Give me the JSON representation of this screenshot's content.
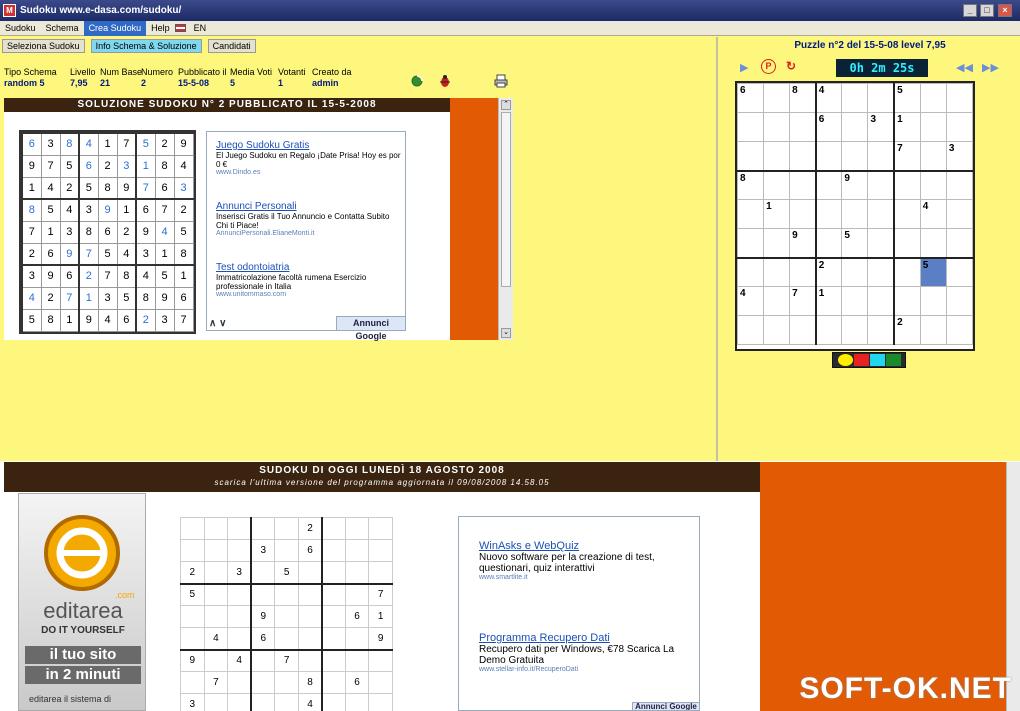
{
  "window": {
    "title": "Sudoku www.e-dasa.com/sudoku/",
    "logo": "M"
  },
  "menu": [
    {
      "label": "Sudoku",
      "active": false
    },
    {
      "label": "Schema",
      "active": false
    },
    {
      "label": "Crea Sudoku",
      "active": true
    },
    {
      "label": "Help",
      "active": false
    },
    {
      "label": "EN",
      "active": false
    }
  ],
  "tabs": [
    "Seleziona Sudoku",
    "Info Schema & Soluzione",
    "Candidati"
  ],
  "info": {
    "labels": [
      "Tipo Schema",
      "Livello",
      "Num Base",
      "Numero",
      "Pubblicato il",
      "Media Voti",
      "Votanti",
      "Creato da"
    ],
    "values": [
      "random 5",
      "7,95",
      "21",
      "2",
      "15-5-08",
      "5",
      "1",
      "admin"
    ]
  },
  "solution": {
    "header": "SOLUZIONE SUDOKU N° 2 PUBBLICATO IL 15-5-2008",
    "grid": [
      [
        "6",
        "3",
        "8",
        "4",
        "1",
        "7",
        "5",
        "2",
        "9"
      ],
      [
        "9",
        "7",
        "5",
        "6",
        "2",
        "3",
        "1",
        "8",
        "4"
      ],
      [
        "1",
        "4",
        "2",
        "5",
        "8",
        "9",
        "7",
        "6",
        "3"
      ],
      [
        "8",
        "5",
        "4",
        "3",
        "9",
        "1",
        "6",
        "7",
        "2"
      ],
      [
        "7",
        "1",
        "3",
        "8",
        "6",
        "2",
        "9",
        "4",
        "5"
      ],
      [
        "2",
        "6",
        "9",
        "7",
        "5",
        "4",
        "3",
        "1",
        "8"
      ],
      [
        "3",
        "9",
        "6",
        "2",
        "7",
        "8",
        "4",
        "5",
        "1"
      ],
      [
        "4",
        "2",
        "7",
        "1",
        "3",
        "5",
        "8",
        "9",
        "6"
      ],
      [
        "5",
        "8",
        "1",
        "9",
        "4",
        "6",
        "2",
        "3",
        "7"
      ]
    ],
    "blue": [
      [
        1,
        0,
        1,
        1,
        0,
        0,
        1,
        0,
        0
      ],
      [
        0,
        0,
        0,
        1,
        0,
        1,
        1,
        0,
        0
      ],
      [
        0,
        0,
        0,
        0,
        0,
        0,
        1,
        0,
        1
      ],
      [
        1,
        0,
        0,
        0,
        1,
        0,
        0,
        0,
        0
      ],
      [
        0,
        0,
        0,
        0,
        0,
        0,
        0,
        1,
        0
      ],
      [
        0,
        0,
        1,
        1,
        0,
        0,
        0,
        0,
        0
      ],
      [
        0,
        0,
        0,
        1,
        0,
        0,
        0,
        0,
        0
      ],
      [
        1,
        0,
        1,
        1,
        0,
        0,
        0,
        0,
        0
      ],
      [
        0,
        0,
        0,
        0,
        0,
        0,
        1,
        0,
        0
      ]
    ]
  },
  "ads_top": [
    {
      "title": "Juego Sudoku Gratis",
      "text": "El Juego Sudoku en Regalo ¡Date Prisa! Hoy es por 0 €",
      "url": "www.Dindo.es"
    },
    {
      "title": "Annunci Personali",
      "text": "Inserisci Gratis il Tuo Annuncio e Contatta Subito Chi ti Piace!",
      "url": "AnnunciPersonali.ElianeMonti.it"
    },
    {
      "title": "Test odontoiatria",
      "text": "Immatricolazione facoltà rumena Esercizio professionale in Italia",
      "url": "www.unitommaso.com"
    }
  ],
  "ads_google": "Annunci Google",
  "ads_nav": "∧ ∨",
  "puzzle": {
    "title": "Puzzle n°2 del 15-5-08 level 7,95",
    "timer": "0h 2m 25s",
    "cells": [
      [
        "6",
        "",
        "8",
        "4",
        "",
        "",
        "5",
        "",
        ""
      ],
      [
        "",
        "",
        "",
        "6",
        "",
        "3",
        "1",
        "",
        ""
      ],
      [
        "",
        "",
        "",
        "",
        "",
        "",
        "7",
        "",
        "3"
      ],
      [
        "8",
        "",
        "",
        "",
        "9",
        "",
        "",
        "",
        ""
      ],
      [
        "",
        "1",
        "",
        "",
        "",
        "",
        "",
        "4",
        ""
      ],
      [
        "",
        "",
        "9",
        "",
        "5",
        "",
        "",
        "",
        ""
      ],
      [
        "",
        "",
        "",
        "2",
        "",
        "",
        "",
        "5",
        ""
      ],
      [
        "4",
        "",
        "7",
        "1",
        "",
        "",
        "",
        "",
        ""
      ],
      [
        "",
        "",
        "",
        "",
        "",
        "",
        "2",
        "",
        ""
      ]
    ],
    "selected": [
      6,
      7
    ],
    "colors": [
      "#ffee00",
      "#e62222",
      "#22d6ee",
      "#1a8a2a"
    ]
  },
  "bottom": {
    "header": "SUDOKU DI OGGI LUNEDÌ 18 AGOSTO 2008",
    "subheader": "scarica l'ultima versione del programma aggiornata il 09/08/2008 14.58.05",
    "grid": [
      [
        "",
        "",
        "",
        "",
        "",
        "2",
        "",
        "",
        ""
      ],
      [
        "",
        "",
        "",
        "3",
        "",
        "6",
        "",
        "",
        ""
      ],
      [
        "2",
        "",
        "3",
        "",
        "5",
        "",
        "",
        "",
        ""
      ],
      [
        "5",
        "",
        "",
        "",
        "",
        "",
        "",
        "",
        "7"
      ],
      [
        "",
        "",
        "",
        "9",
        "",
        "",
        "",
        "6",
        "1"
      ],
      [
        "",
        "4",
        "",
        "6",
        "",
        "",
        "",
        "",
        "9"
      ],
      [
        "9",
        "",
        "4",
        "",
        "7",
        "",
        "",
        "",
        ""
      ],
      [
        "",
        "7",
        "",
        "",
        "",
        "8",
        "",
        "6",
        ""
      ],
      [
        "3",
        "",
        "",
        "",
        "",
        "4",
        "",
        "",
        ""
      ]
    ]
  },
  "editarea": {
    "brand": "editarea",
    "com": ".com",
    "tagline": "DO IT YOURSELF",
    "line1": "il tuo sito",
    "line2": "in 2 minuti",
    "footer": "editarea il sistema di"
  },
  "ads_bottom": [
    {
      "title": "WinAsks e WebQuiz",
      "text": "Nuovo software per la creazione di test, questionari, quiz interattivi",
      "url": "www.smartlite.it"
    },
    {
      "title": "Programma Recupero Dati",
      "text": "Recupero dati per Windows, €78 Scarica La Demo Gratuita",
      "url": "www.stellar-info.it/RecuperoDati"
    }
  ],
  "ads_bottom_google": "Annunci Google",
  "watermark": "SOFT-OK.NET"
}
